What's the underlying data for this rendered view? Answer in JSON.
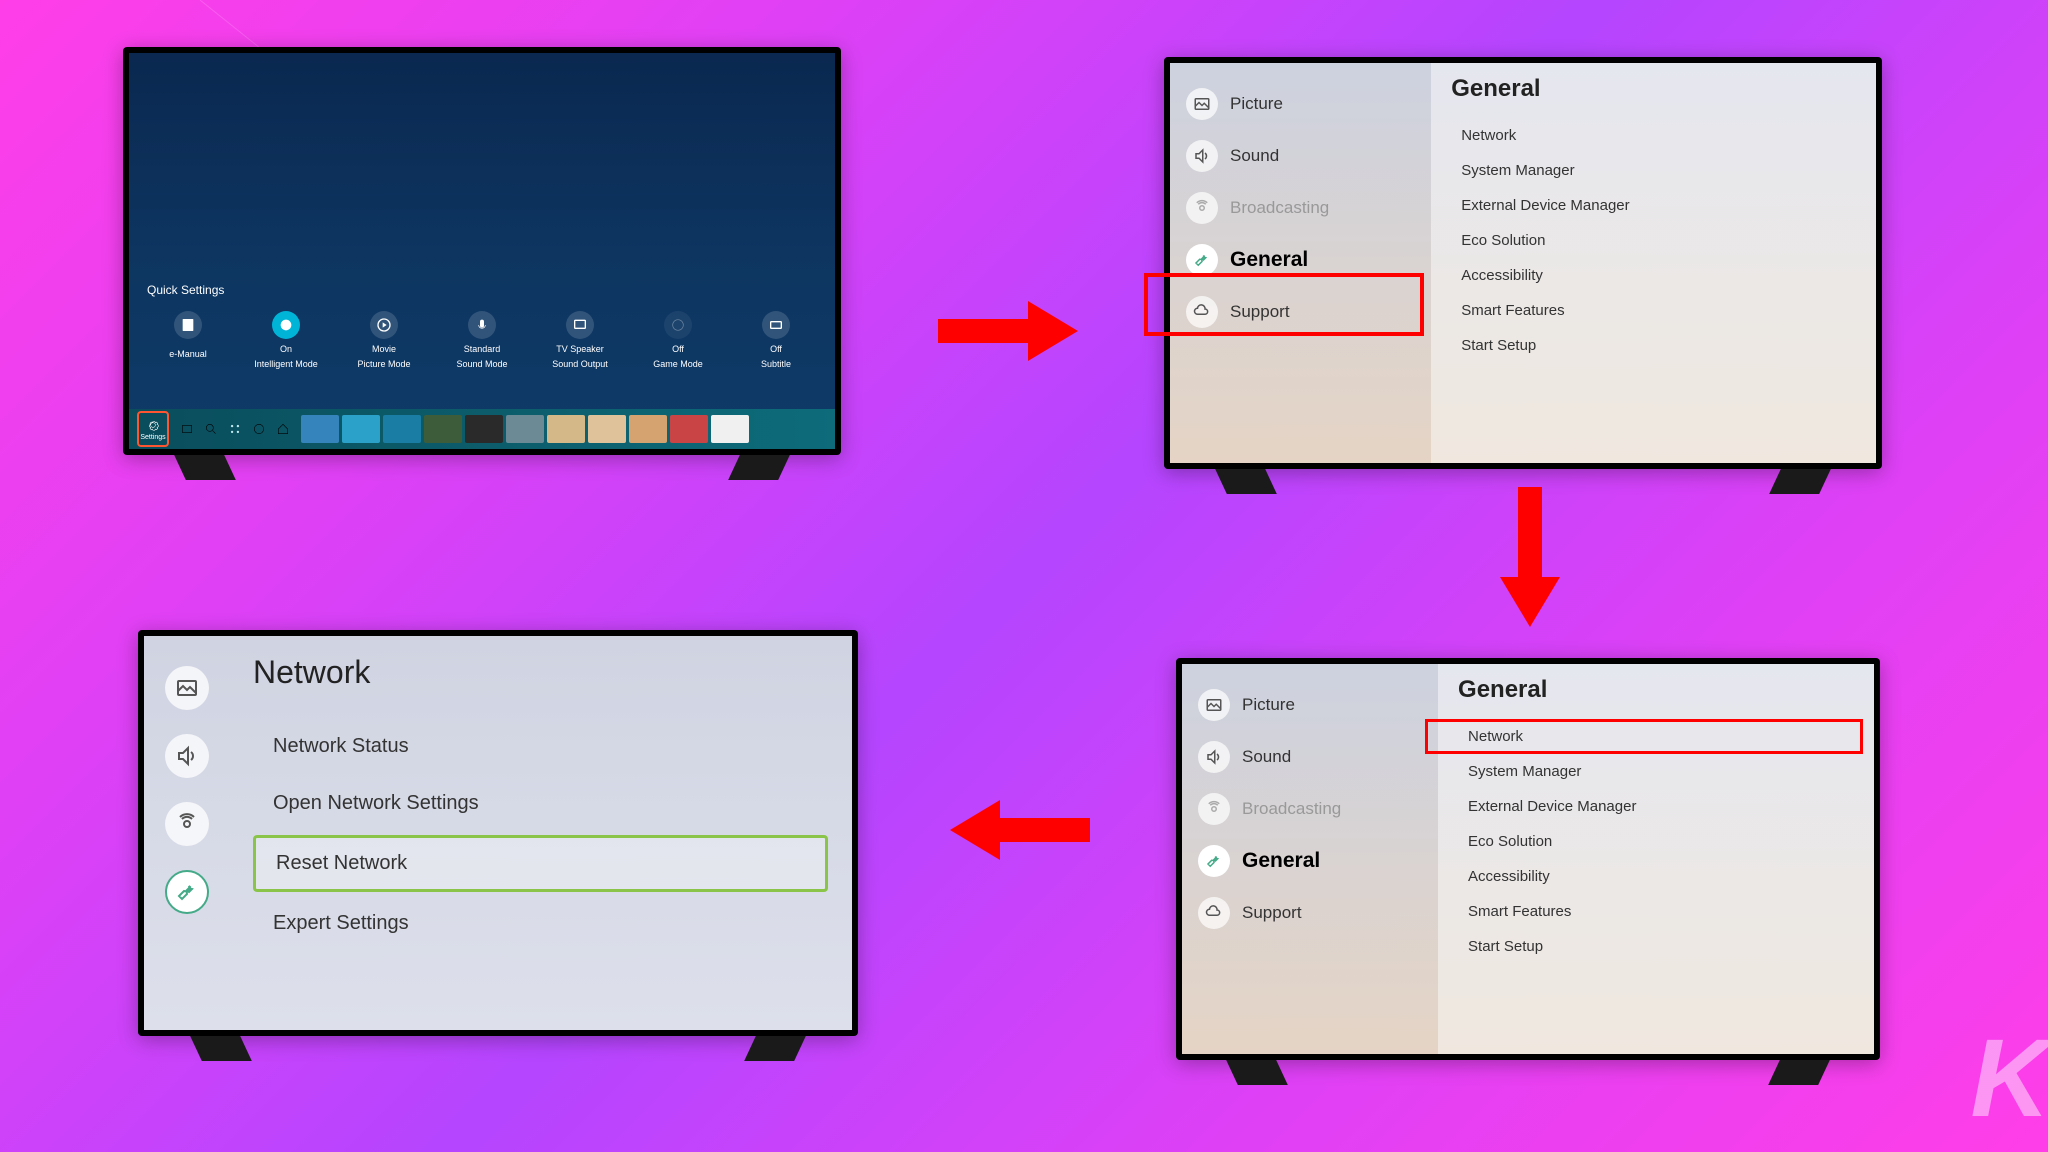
{
  "screen1": {
    "qs_label": "Quick Settings",
    "items": [
      {
        "label1": "",
        "label2": "e-Manual"
      },
      {
        "label1": "On",
        "label2": "Intelligent Mode"
      },
      {
        "label1": "Movie",
        "label2": "Picture Mode"
      },
      {
        "label1": "Standard",
        "label2": "Sound Mode"
      },
      {
        "label1": "TV Speaker",
        "label2": "Sound Output"
      },
      {
        "label1": "Off",
        "label2": "Game Mode"
      },
      {
        "label1": "Off",
        "label2": "Subtitle"
      }
    ],
    "settings_label": "Settings"
  },
  "screen2": {
    "title": "General",
    "sidebar": [
      {
        "label": "Picture"
      },
      {
        "label": "Sound"
      },
      {
        "label": "Broadcasting"
      },
      {
        "label": "General"
      },
      {
        "label": "Support"
      }
    ],
    "options": [
      "Network",
      "System Manager",
      "External Device Manager",
      "Eco Solution",
      "Accessibility",
      "Smart Features",
      "Start Setup"
    ]
  },
  "screen3": {
    "title": "General",
    "sidebar": [
      {
        "label": "Picture"
      },
      {
        "label": "Sound"
      },
      {
        "label": "Broadcasting"
      },
      {
        "label": "General"
      },
      {
        "label": "Support"
      }
    ],
    "options": [
      "Network",
      "System Manager",
      "External Device Manager",
      "Eco Solution",
      "Accessibility",
      "Smart Features",
      "Start Setup"
    ]
  },
  "screen4": {
    "title": "Network",
    "options": [
      "Network Status",
      "Open Network Settings",
      "Reset Network",
      "Expert Settings"
    ]
  },
  "watermark": "K"
}
